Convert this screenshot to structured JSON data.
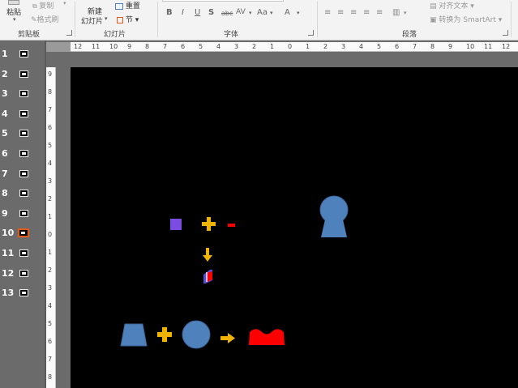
{
  "ribbon": {
    "clipboard": {
      "paste": "粘贴",
      "copy": "复制",
      "format_painter": "格式刷",
      "group_label": "剪贴板"
    },
    "slides": {
      "new_slide_line1": "新建",
      "new_slide_line2": "幻灯片",
      "reset": "重置",
      "section": "节",
      "group_label": "幻灯片"
    },
    "font": {
      "bold": "B",
      "italic": "I",
      "underline": "U",
      "shadow": "S",
      "strikethrough": "abc",
      "spacing": "AV",
      "case": "Aa",
      "color": "A",
      "group_label": "字体"
    },
    "paragraph": {
      "align_text": "对齐文本",
      "convert_smartart": "转换为 SmartArt",
      "group_label": "段落"
    }
  },
  "thumbnails": [
    {
      "num": "1"
    },
    {
      "num": "2"
    },
    {
      "num": "3"
    },
    {
      "num": "4"
    },
    {
      "num": "5"
    },
    {
      "num": "6"
    },
    {
      "num": "7"
    },
    {
      "num": "8"
    },
    {
      "num": "9"
    },
    {
      "num": "10",
      "selected": true
    },
    {
      "num": "11"
    },
    {
      "num": "12"
    },
    {
      "num": "13"
    }
  ],
  "hruler_labels": [
    "12",
    "11",
    "10",
    "9",
    "8",
    "7",
    "6",
    "5",
    "4",
    "3",
    "2",
    "1",
    "0",
    "1",
    "2",
    "3",
    "4",
    "5",
    "6",
    "7",
    "8",
    "9",
    "10",
    "11",
    "12"
  ],
  "vruler_labels": [
    "9",
    "8",
    "7",
    "6",
    "5",
    "4",
    "3",
    "2",
    "1",
    "0",
    "1",
    "2",
    "3",
    "4",
    "5",
    "6",
    "7",
    "8"
  ],
  "colors": {
    "accent_blue": "#4f81bd",
    "purple": "#7b4ce0",
    "gold": "#f0b400",
    "red": "#ff0000",
    "selected_thumb": "#e05a1a"
  },
  "icons": {
    "slide_shapes": [
      "purple-square",
      "plus-sign",
      "red-small-shape",
      "down-arrow",
      "cube-shape",
      "keyhole-shape",
      "trapezoid-shape",
      "plus-sign",
      "circle-shape",
      "right-arrow",
      "red-arch-shape"
    ]
  }
}
